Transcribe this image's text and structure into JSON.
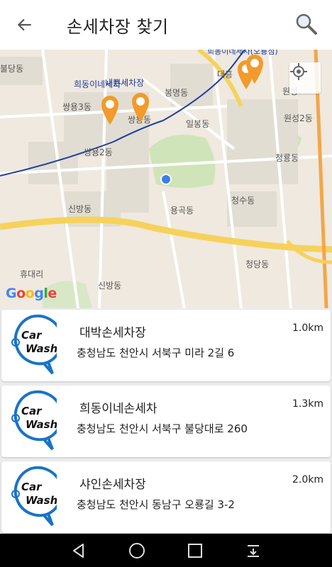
{
  "header": {
    "title": "손세차장 찾기",
    "back_icon": "arrow-left-icon",
    "search_icon": "search-icon"
  },
  "map": {
    "labels": {
      "bulgang": "불당동",
      "heedong": "희동이네세차",
      "naebun": "내쁜세차장",
      "ssangyong3": "쌍용3동",
      "ssangyong": "쌍용동",
      "bongmyeong": "봉명동",
      "ilbong": "일봉동",
      "ssangyong2": "쌍용2동",
      "daeheung": "대흥",
      "wonseong2": "원성2동",
      "wonseong": "원성",
      "cheongryong": "청룡동",
      "cheongsu": "청수동",
      "singbang": "신방동",
      "yonggok": "용곡동",
      "cheongdang": "청당동",
      "hyudae": "휴대리",
      "sinbang2": "신방동",
      "topclip": "희동이네세차(오룡점)"
    },
    "google": "Google",
    "locate_icon": "my-location-icon",
    "colors": {
      "accent": "#f29a2b",
      "road_yellow": "#f6d25b",
      "rail_blue": "#1f3fa3"
    }
  },
  "results": [
    {
      "name": "대박손세차장",
      "distance": "1.0km",
      "address": "충청남도 천안시 서북구 미라 2길 6",
      "logo_line1": "Car",
      "logo_line2": "Wash"
    },
    {
      "name": "희동이네손세차",
      "distance": "1.3km",
      "address": "충청남도 천안시 서북구 불당대로 260",
      "logo_line1": "Car",
      "logo_line2": "Wash"
    },
    {
      "name": "샤인손세차장",
      "distance": "2.0km",
      "address": "충청남도 천안시 동남구 오룡길 3-2",
      "logo_line1": "Car",
      "logo_line2": "Wash"
    }
  ],
  "nav": {
    "back_icon": "nav-back-icon",
    "home_icon": "nav-home-icon",
    "recent_icon": "nav-recents-icon",
    "menu_icon": "nav-menu-icon"
  }
}
